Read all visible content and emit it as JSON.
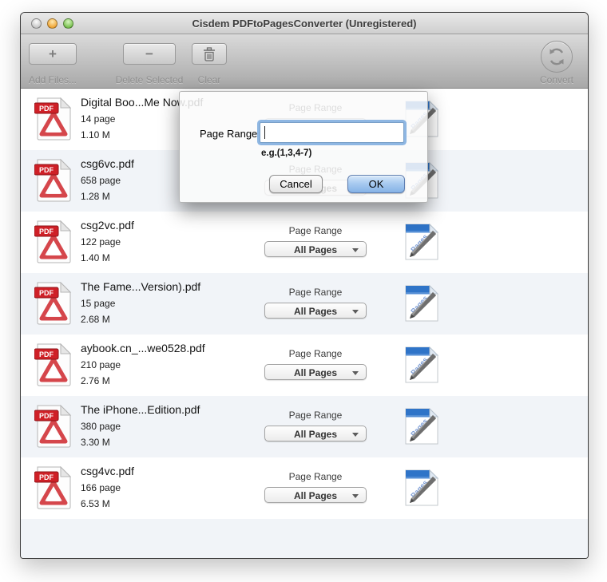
{
  "window": {
    "title": "Cisdem PDFtoPagesConverter (Unregistered)"
  },
  "toolbar": {
    "add_files_label": "Add Files...",
    "add_icon_glyph": "+",
    "delete_selected_label": "Delete Selected",
    "delete_icon_glyph": "−",
    "clear_label": "Clear",
    "convert_label": "Convert"
  },
  "list": {
    "page_range_label": "Page Range",
    "dropdown_value": "All Pages",
    "files": [
      {
        "name": "Digital Boo...Me Now.pdf",
        "pages": "14 page",
        "size": "1.10 M"
      },
      {
        "name": "csg6vc.pdf",
        "pages": "658 page",
        "size": "1.28 M"
      },
      {
        "name": "csg2vc.pdf",
        "pages": "122 page",
        "size": "1.40 M"
      },
      {
        "name": "The Fame...Version).pdf",
        "pages": "15 page",
        "size": "2.68 M"
      },
      {
        "name": "aybook.cn_...we0528.pdf",
        "pages": "210 page",
        "size": "2.76 M"
      },
      {
        "name": "The iPhone...Edition.pdf",
        "pages": "380 page",
        "size": "3.30 M"
      },
      {
        "name": "csg4vc.pdf",
        "pages": "166 page",
        "size": "6.53 M"
      }
    ]
  },
  "dialog": {
    "label": "Page Range",
    "input_value": "",
    "hint": "e.g.(1,3,4-7)",
    "cancel_label": "Cancel",
    "ok_label": "OK"
  },
  "colors": {
    "ok_button_blue": "#85b2e6",
    "focus_ring_blue": "#73a5dc",
    "pdf_red": "#cc2229",
    "pages_blue": "#2f74c8",
    "row_alt": "#f1f4f8"
  }
}
